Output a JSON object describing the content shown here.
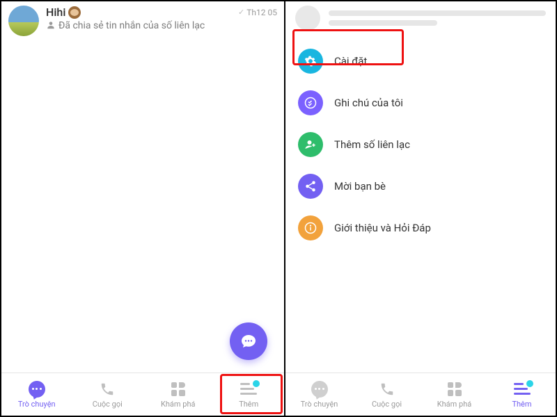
{
  "left": {
    "chat": {
      "name": "Hihi",
      "time": "Th12 05",
      "preview": "Đã chia sẻ tin nhắn của số liên lạc"
    },
    "nav": {
      "chat": "Trò chuyện",
      "calls": "Cuộc gọi",
      "explore": "Khám phá",
      "more": "Thêm"
    }
  },
  "right": {
    "menu": {
      "settings": "Cài đặt",
      "notes": "Ghi chú của tôi",
      "addct": "Thêm số liên lạc",
      "invite": "Mời bạn bè",
      "about": "Giới thiệu và Hỏi Đáp"
    },
    "nav": {
      "chat": "Trò chuyện",
      "calls": "Cuộc gọi",
      "explore": "Khám phá",
      "more": "Thêm"
    }
  }
}
